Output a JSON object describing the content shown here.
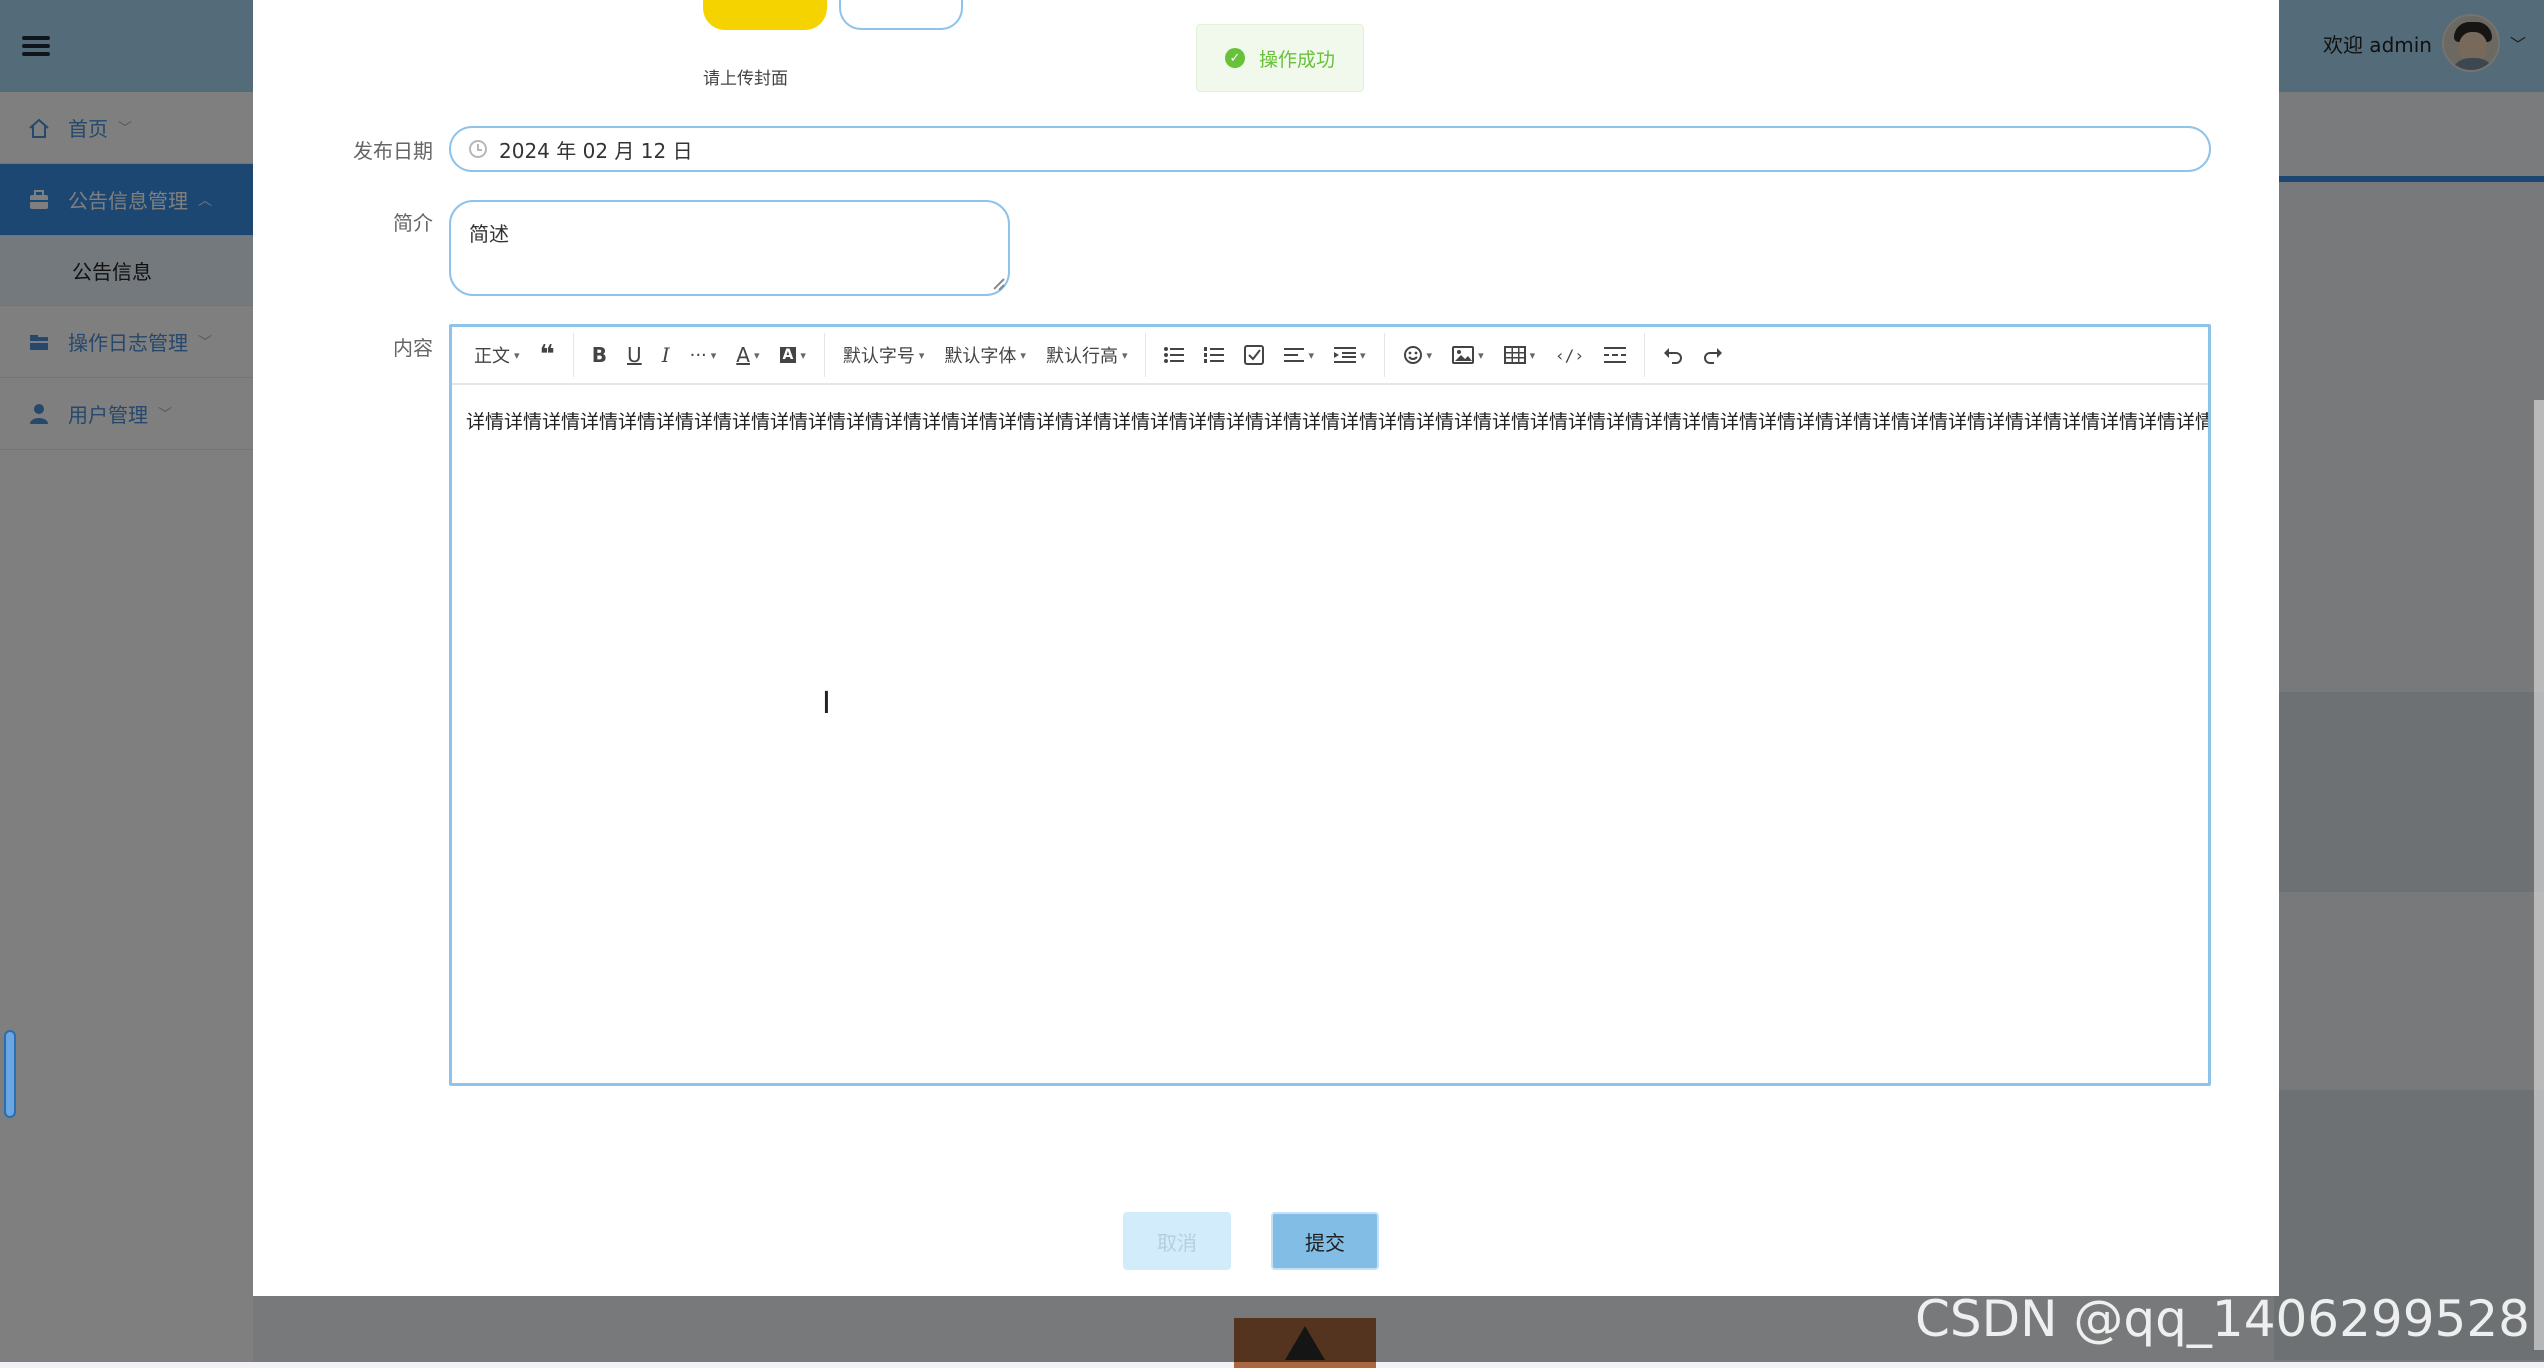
{
  "sidebar": {
    "items": [
      {
        "label": "首页",
        "icon": "home-icon",
        "active": false
      },
      {
        "label": "公告信息管理",
        "icon": "briefcase-icon",
        "active": true,
        "sub": [
          {
            "label": "公告信息"
          }
        ]
      },
      {
        "label": "操作日志管理",
        "icon": "folder-icon",
        "active": false
      },
      {
        "label": "用户管理",
        "icon": "user-icon",
        "active": false
      }
    ]
  },
  "header": {
    "welcome": "欢迎 admin"
  },
  "toast": {
    "message": "操作成功",
    "color": "#67c23a"
  },
  "form": {
    "cover_hint": "请上传封面",
    "date_label": "发布日期",
    "date_value": "2024 年 02 月 12 日",
    "summary_label": "简介",
    "summary_value": "简述",
    "content_label": "内容",
    "content_text": "详情详情详情详情详情详情详情详情详情详情详情详情详情详情详情详情详情详情详情详情详情详情详情详情详情详情详情详情详情详情详情详情详情详情详情详情详情详情详情详情详情详情详情详情详情详情详情详情详情详情详情详情详情详情详情"
  },
  "toolbar": {
    "paragraph": "正文",
    "fontsize": "默认字号",
    "fontfamily": "默认字体",
    "lineheight": "默认行高"
  },
  "buttons": {
    "cancel": "取消",
    "submit": "提交"
  },
  "watermark": "CSDN @qq_1406299528",
  "colors": {
    "accent": "#3a8ee6",
    "header": "#a8d6f3",
    "border": "#8ec3ea",
    "cover_button": "#f5d300"
  }
}
